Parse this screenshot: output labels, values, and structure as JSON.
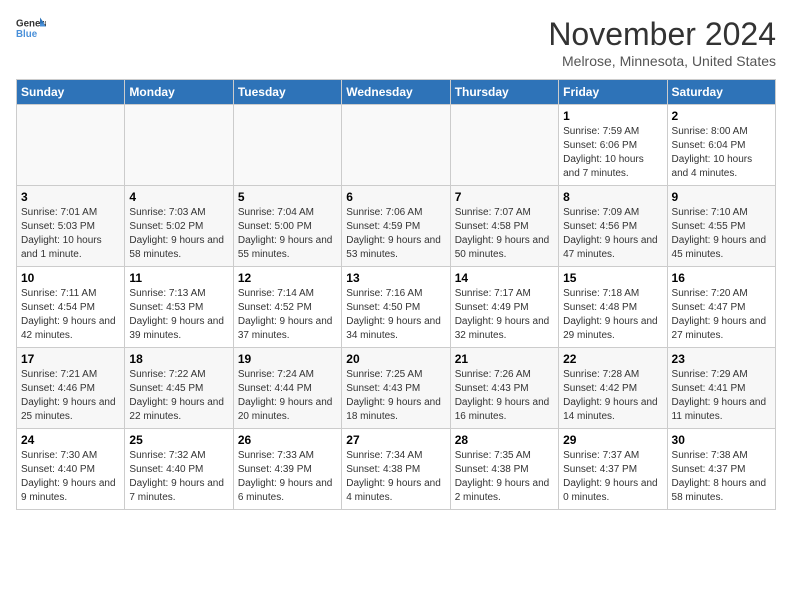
{
  "header": {
    "logo_general": "General",
    "logo_blue": "Blue",
    "month_title": "November 2024",
    "location": "Melrose, Minnesota, United States"
  },
  "days_of_week": [
    "Sunday",
    "Monday",
    "Tuesday",
    "Wednesday",
    "Thursday",
    "Friday",
    "Saturday"
  ],
  "weeks": [
    [
      {
        "day": "",
        "info": ""
      },
      {
        "day": "",
        "info": ""
      },
      {
        "day": "",
        "info": ""
      },
      {
        "day": "",
        "info": ""
      },
      {
        "day": "",
        "info": ""
      },
      {
        "day": "1",
        "info": "Sunrise: 7:59 AM\nSunset: 6:06 PM\nDaylight: 10 hours and 7 minutes."
      },
      {
        "day": "2",
        "info": "Sunrise: 8:00 AM\nSunset: 6:04 PM\nDaylight: 10 hours and 4 minutes."
      }
    ],
    [
      {
        "day": "3",
        "info": "Sunrise: 7:01 AM\nSunset: 5:03 PM\nDaylight: 10 hours and 1 minute."
      },
      {
        "day": "4",
        "info": "Sunrise: 7:03 AM\nSunset: 5:02 PM\nDaylight: 9 hours and 58 minutes."
      },
      {
        "day": "5",
        "info": "Sunrise: 7:04 AM\nSunset: 5:00 PM\nDaylight: 9 hours and 55 minutes."
      },
      {
        "day": "6",
        "info": "Sunrise: 7:06 AM\nSunset: 4:59 PM\nDaylight: 9 hours and 53 minutes."
      },
      {
        "day": "7",
        "info": "Sunrise: 7:07 AM\nSunset: 4:58 PM\nDaylight: 9 hours and 50 minutes."
      },
      {
        "day": "8",
        "info": "Sunrise: 7:09 AM\nSunset: 4:56 PM\nDaylight: 9 hours and 47 minutes."
      },
      {
        "day": "9",
        "info": "Sunrise: 7:10 AM\nSunset: 4:55 PM\nDaylight: 9 hours and 45 minutes."
      }
    ],
    [
      {
        "day": "10",
        "info": "Sunrise: 7:11 AM\nSunset: 4:54 PM\nDaylight: 9 hours and 42 minutes."
      },
      {
        "day": "11",
        "info": "Sunrise: 7:13 AM\nSunset: 4:53 PM\nDaylight: 9 hours and 39 minutes."
      },
      {
        "day": "12",
        "info": "Sunrise: 7:14 AM\nSunset: 4:52 PM\nDaylight: 9 hours and 37 minutes."
      },
      {
        "day": "13",
        "info": "Sunrise: 7:16 AM\nSunset: 4:50 PM\nDaylight: 9 hours and 34 minutes."
      },
      {
        "day": "14",
        "info": "Sunrise: 7:17 AM\nSunset: 4:49 PM\nDaylight: 9 hours and 32 minutes."
      },
      {
        "day": "15",
        "info": "Sunrise: 7:18 AM\nSunset: 4:48 PM\nDaylight: 9 hours and 29 minutes."
      },
      {
        "day": "16",
        "info": "Sunrise: 7:20 AM\nSunset: 4:47 PM\nDaylight: 9 hours and 27 minutes."
      }
    ],
    [
      {
        "day": "17",
        "info": "Sunrise: 7:21 AM\nSunset: 4:46 PM\nDaylight: 9 hours and 25 minutes."
      },
      {
        "day": "18",
        "info": "Sunrise: 7:22 AM\nSunset: 4:45 PM\nDaylight: 9 hours and 22 minutes."
      },
      {
        "day": "19",
        "info": "Sunrise: 7:24 AM\nSunset: 4:44 PM\nDaylight: 9 hours and 20 minutes."
      },
      {
        "day": "20",
        "info": "Sunrise: 7:25 AM\nSunset: 4:43 PM\nDaylight: 9 hours and 18 minutes."
      },
      {
        "day": "21",
        "info": "Sunrise: 7:26 AM\nSunset: 4:43 PM\nDaylight: 9 hours and 16 minutes."
      },
      {
        "day": "22",
        "info": "Sunrise: 7:28 AM\nSunset: 4:42 PM\nDaylight: 9 hours and 14 minutes."
      },
      {
        "day": "23",
        "info": "Sunrise: 7:29 AM\nSunset: 4:41 PM\nDaylight: 9 hours and 11 minutes."
      }
    ],
    [
      {
        "day": "24",
        "info": "Sunrise: 7:30 AM\nSunset: 4:40 PM\nDaylight: 9 hours and 9 minutes."
      },
      {
        "day": "25",
        "info": "Sunrise: 7:32 AM\nSunset: 4:40 PM\nDaylight: 9 hours and 7 minutes."
      },
      {
        "day": "26",
        "info": "Sunrise: 7:33 AM\nSunset: 4:39 PM\nDaylight: 9 hours and 6 minutes."
      },
      {
        "day": "27",
        "info": "Sunrise: 7:34 AM\nSunset: 4:38 PM\nDaylight: 9 hours and 4 minutes."
      },
      {
        "day": "28",
        "info": "Sunrise: 7:35 AM\nSunset: 4:38 PM\nDaylight: 9 hours and 2 minutes."
      },
      {
        "day": "29",
        "info": "Sunrise: 7:37 AM\nSunset: 4:37 PM\nDaylight: 9 hours and 0 minutes."
      },
      {
        "day": "30",
        "info": "Sunrise: 7:38 AM\nSunset: 4:37 PM\nDaylight: 8 hours and 58 minutes."
      }
    ]
  ]
}
